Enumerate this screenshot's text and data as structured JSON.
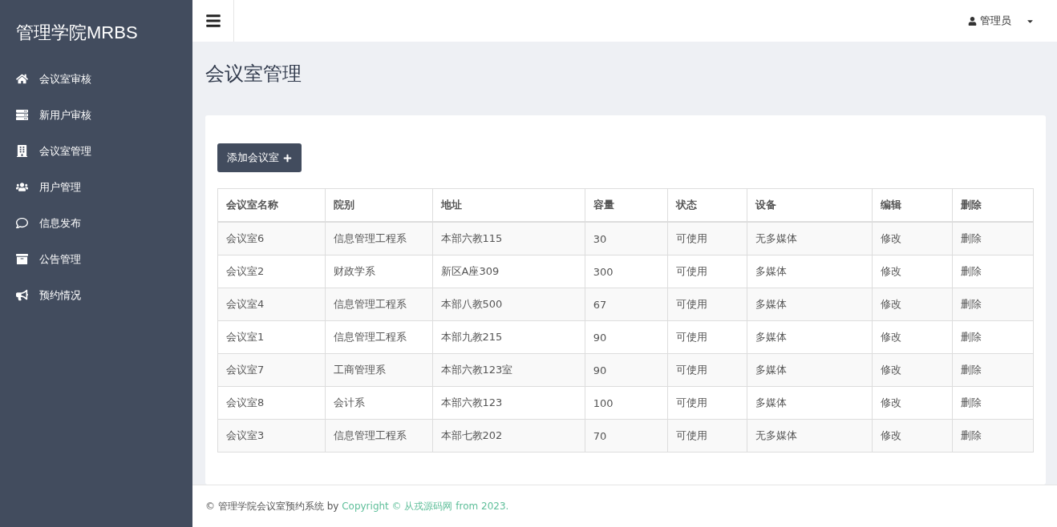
{
  "sidebar": {
    "brand": "管理学院MRBS",
    "items": [
      {
        "label": "会议室审核"
      },
      {
        "label": "新用户审核"
      },
      {
        "label": "会议室管理"
      },
      {
        "label": "用户管理"
      },
      {
        "label": "信息发布"
      },
      {
        "label": "公告管理"
      },
      {
        "label": "预约情况"
      }
    ]
  },
  "topbar": {
    "user": "管理员"
  },
  "page_title": "会议室管理",
  "add_button": "添加会议室",
  "table": {
    "columns": [
      "会议室名称",
      "院别",
      "地址",
      "容量",
      "状态",
      "设备",
      "编辑",
      "删除"
    ],
    "rows": [
      [
        "会议室6",
        "信息管理工程系",
        "本部六教115",
        "30",
        "可使用",
        "无多媒体",
        "修改",
        "删除"
      ],
      [
        "会议室2",
        "财政学系",
        "新区A座309",
        "300",
        "可使用",
        "多媒体",
        "修改",
        "删除"
      ],
      [
        "会议室4",
        "信息管理工程系",
        "本部八教500",
        "67",
        "可使用",
        "多媒体",
        "修改",
        "删除"
      ],
      [
        "会议室1",
        "信息管理工程系",
        "本部九教215",
        "90",
        "可使用",
        "多媒体",
        "修改",
        "删除"
      ],
      [
        "会议室7",
        "工商管理系",
        "本部六教123室",
        "90",
        "可使用",
        "多媒体",
        "修改",
        "删除"
      ],
      [
        "会议室8",
        "会计系",
        "本部六教123",
        "100",
        "可使用",
        "多媒体",
        "修改",
        "删除"
      ],
      [
        "会议室3",
        "信息管理工程系",
        "本部七教202",
        "70",
        "可使用",
        "无多媒体",
        "修改",
        "删除"
      ]
    ]
  },
  "footer": {
    "text": "© 管理学院会议室预约系统 by ",
    "link": "Copyright © 从戎源码网 from 2023."
  }
}
